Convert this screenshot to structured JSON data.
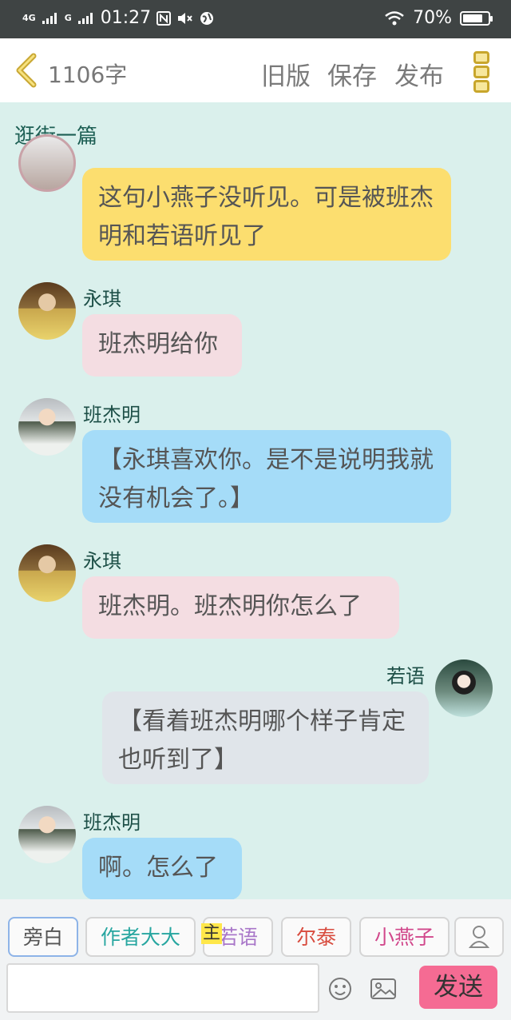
{
  "status_bar": {
    "network_1": "4G",
    "network_2": "G",
    "time": "01:27",
    "battery": "70%"
  },
  "toolbar": {
    "word_count": "1106字",
    "old_version": "旧版",
    "save": "保存",
    "publish": "发布"
  },
  "chat": {
    "title": "逛街一篇",
    "messages": [
      {
        "speaker": "",
        "text": "这句小燕子没听见。可是被班杰明和若语听见了",
        "style": "yellow"
      },
      {
        "speaker": "永琪",
        "text": "班杰明给你",
        "style": "pink"
      },
      {
        "speaker": "班杰明",
        "text": "【永琪喜欢你。是不是说明我就没有机会了。】",
        "style": "blue"
      },
      {
        "speaker": "永琪",
        "text": "班杰明。班杰明你怎么了",
        "style": "pink"
      },
      {
        "speaker": "若语",
        "text": "【看着班杰明哪个样子肯定也听到了】",
        "style": "gray"
      },
      {
        "speaker": "班杰明",
        "text": "啊。怎么了",
        "style": "blue"
      }
    ]
  },
  "role_bar": {
    "roles": [
      {
        "label": "旁白",
        "color": "#555555"
      },
      {
        "label": "作者大大",
        "color": "#27a6a0"
      },
      {
        "label": "若语",
        "color": "#a977c9"
      },
      {
        "label": "尔泰",
        "color": "#d84c3f"
      },
      {
        "label": "小燕子",
        "color": "#d1478b"
      }
    ],
    "host_badge": "主",
    "message_input_value": "",
    "send_label": "发送"
  }
}
